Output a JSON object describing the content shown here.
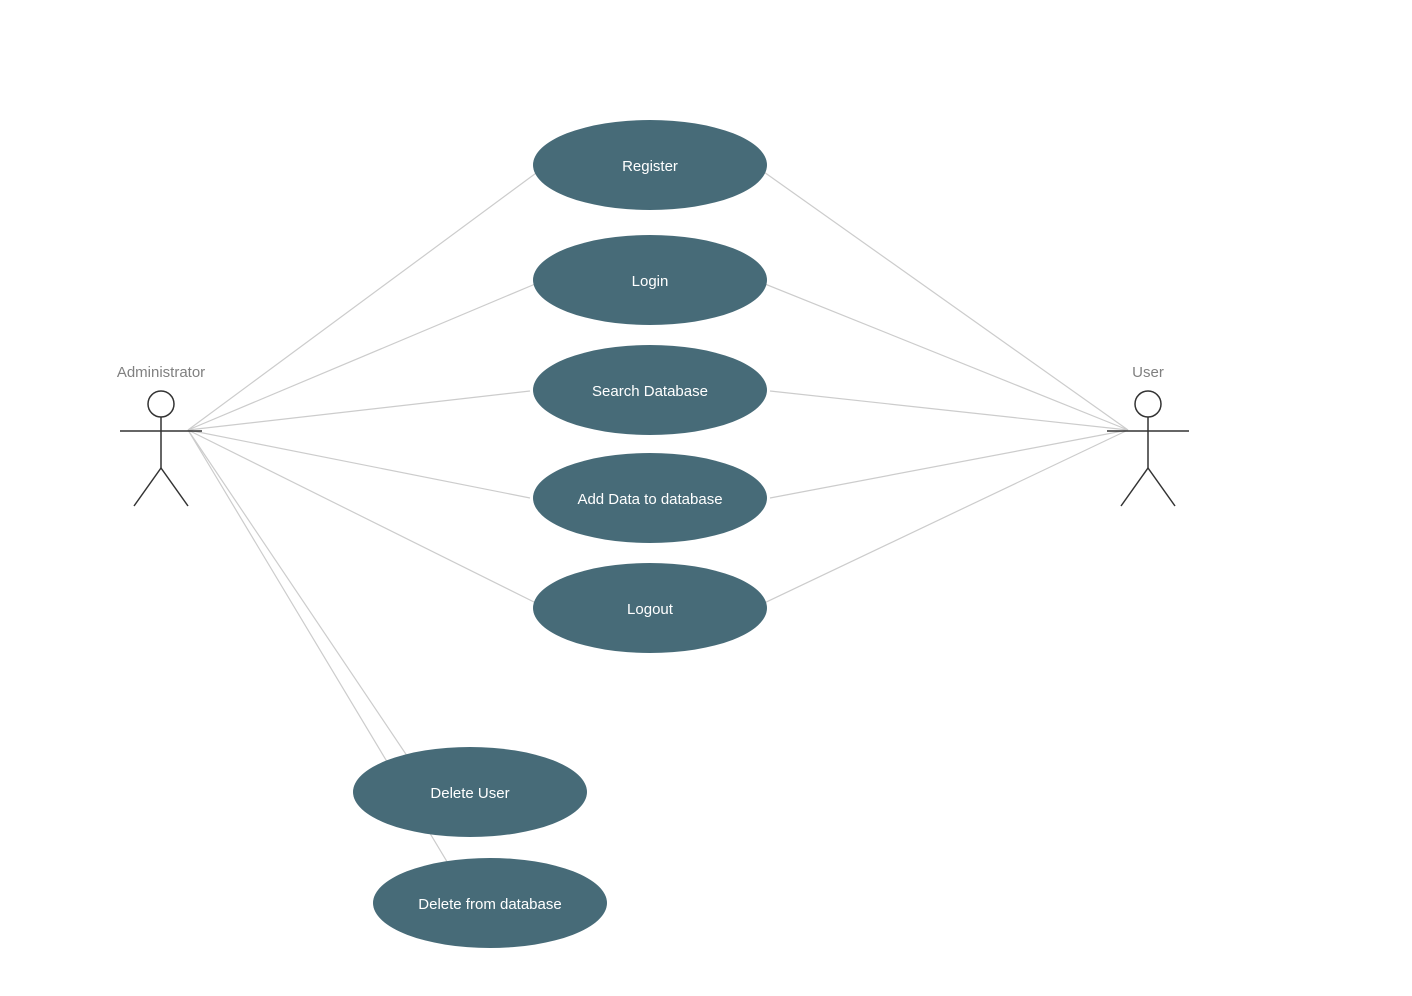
{
  "actors": {
    "admin": {
      "label": "Administrator"
    },
    "user": {
      "label": "User"
    }
  },
  "usecases": {
    "register": {
      "label": "Register"
    },
    "login": {
      "label": "Login"
    },
    "search": {
      "label": "Search Database"
    },
    "adddata": {
      "label": "Add Data to database"
    },
    "logout": {
      "label": "Logout"
    },
    "deluser": {
      "label": "Delete User"
    },
    "delfromdb": {
      "label": "Delete  from database"
    }
  },
  "colors": {
    "usecase_fill": "#476b78",
    "connector": "#cccccc",
    "actor_label": "#808080",
    "usecase_text": "#ffffff"
  }
}
